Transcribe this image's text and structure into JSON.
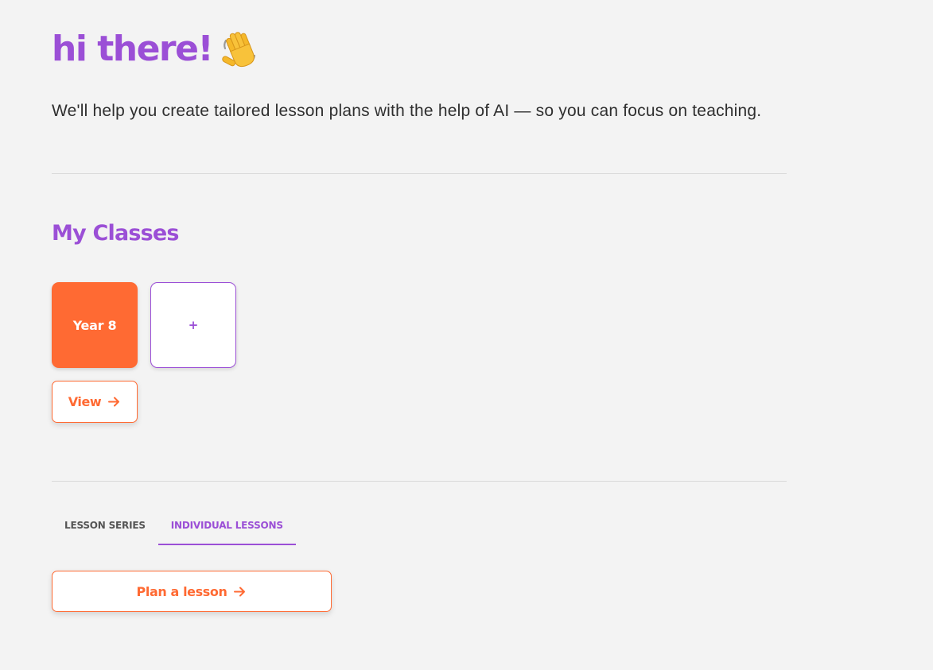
{
  "greeting": {
    "text": "hi there!",
    "icon": "waving-hand-icon"
  },
  "intro": "We'll help you create tailored lesson plans with the help of AI — so you can focus on teaching.",
  "classes": {
    "title": "My Classes",
    "items": [
      {
        "label": "Year 8"
      }
    ],
    "add_label": "+",
    "view_label": "View"
  },
  "tabs": [
    {
      "label": "LESSON SERIES",
      "active": false
    },
    {
      "label": "INDIVIDUAL LESSONS",
      "active": true
    }
  ],
  "plan_label": "Plan a lesson",
  "colors": {
    "accent_purple": "#9b4fd6",
    "accent_orange": "#ff6a33",
    "background": "#f3f3f3"
  }
}
